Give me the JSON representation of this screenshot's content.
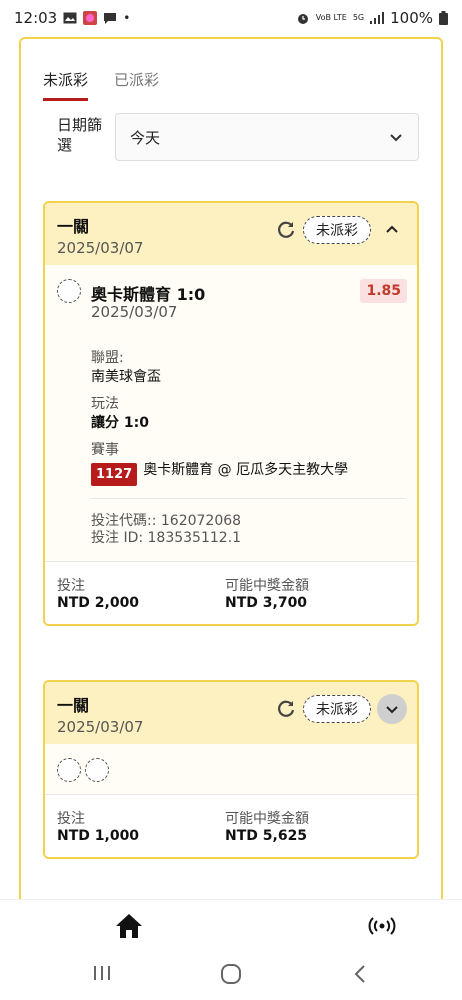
{
  "status_bar": {
    "time": "12:03",
    "battery": "100%",
    "network_small": "5G",
    "volte": "VoB LTE"
  },
  "tabs": [
    {
      "label": "未派彩",
      "active": true
    },
    {
      "label": "已派彩",
      "active": false
    }
  ],
  "filter": {
    "label": "日期篩選",
    "selected": "今天"
  },
  "bets": [
    {
      "type": "一關",
      "date": "2025/03/07",
      "status": "未派彩",
      "expanded": true,
      "selection": {
        "title": "奧卡斯體育 1:0",
        "date": "2025/03/07",
        "odds": "1.85",
        "league_label": "聯盟:",
        "league": "南美球會盃",
        "play_label": "玩法",
        "play": "讓分 1:0",
        "event_label": "賽事",
        "event_id": "1127",
        "event_name": "奧卡斯體育 @ 厄瓜多天主教大學"
      },
      "bet_code": "投注代碼:: 162072068",
      "bet_id": "投注 ID: 183535112.1",
      "stake_label": "投注",
      "stake": "NTD 2,000",
      "win_label": "可能中獎金額",
      "win": "NTD 3,700"
    },
    {
      "type": "一關",
      "date": "2025/03/07",
      "status": "未派彩",
      "expanded": false,
      "stake_label": "投注",
      "stake": "NTD 1,000",
      "win_label": "可能中獎金額",
      "win": "NTD 5,625"
    }
  ],
  "colors": {
    "accent_yellow": "#f2d24a",
    "header_yellow": "#fdf1c2",
    "brand_red": "#b71c1c",
    "odds_red": "#c0392b"
  },
  "icons": [
    "home-icon",
    "live-broadcast-icon",
    "refresh-icon",
    "chevron-up-icon",
    "chevron-down-icon"
  ]
}
